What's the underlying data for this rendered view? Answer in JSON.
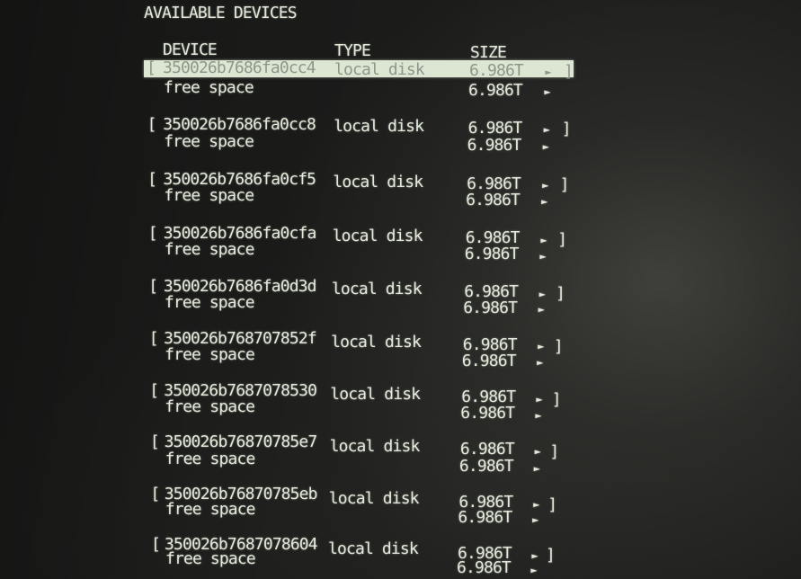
{
  "screen": {
    "section_title": "AVAILABLE DEVICES",
    "columns": {
      "device": "DEVICE",
      "type": "TYPE",
      "size": "SIZE"
    }
  },
  "glyphs": {
    "open_bracket": "[",
    "close_bracket": "]",
    "menu_arrow": "►"
  },
  "icons": {
    "menu_arrow": "actions-menu-arrow-icon"
  },
  "colors": {
    "background": "#1c1c1b",
    "text": "#e2e8da",
    "selected_row_background": "#dde6d3",
    "selected_row_text": "#8e9689"
  },
  "devices": [
    {
      "name": "350026b7686fa0cc4",
      "type": "local disk",
      "size": "6.986T",
      "selected": true,
      "free_space": {
        "label": "free space",
        "size": "6.986T"
      }
    },
    {
      "name": "350026b7686fa0cc8",
      "type": "local disk",
      "size": "6.986T",
      "selected": false,
      "free_space": {
        "label": "free space",
        "size": "6.986T"
      }
    },
    {
      "name": "350026b7686fa0cf5",
      "type": "local disk",
      "size": "6.986T",
      "selected": false,
      "free_space": {
        "label": "free space",
        "size": "6.986T"
      }
    },
    {
      "name": "350026b7686fa0cfa",
      "type": "local disk",
      "size": "6.986T",
      "selected": false,
      "free_space": {
        "label": "free space",
        "size": "6.986T"
      }
    },
    {
      "name": "350026b7686fa0d3d",
      "type": "local disk",
      "size": "6.986T",
      "selected": false,
      "free_space": {
        "label": "free space",
        "size": "6.986T"
      }
    },
    {
      "name": "350026b768707852f",
      "type": "local disk",
      "size": "6.986T",
      "selected": false,
      "free_space": {
        "label": "free space",
        "size": "6.986T"
      }
    },
    {
      "name": "350026b7687078530",
      "type": "local disk",
      "size": "6.986T",
      "selected": false,
      "free_space": {
        "label": "free space",
        "size": "6.986T"
      }
    },
    {
      "name": "350026b76870785e7",
      "type": "local disk",
      "size": "6.986T",
      "selected": false,
      "free_space": {
        "label": "free space",
        "size": "6.986T"
      }
    },
    {
      "name": "350026b76870785eb",
      "type": "local disk",
      "size": "6.986T",
      "selected": false,
      "free_space": {
        "label": "free space",
        "size": "6.986T"
      }
    },
    {
      "name": "350026b7687078604",
      "type": "local disk",
      "size": "6.986T",
      "selected": false,
      "free_space": {
        "label": "free space",
        "size": "6.986T"
      }
    }
  ]
}
